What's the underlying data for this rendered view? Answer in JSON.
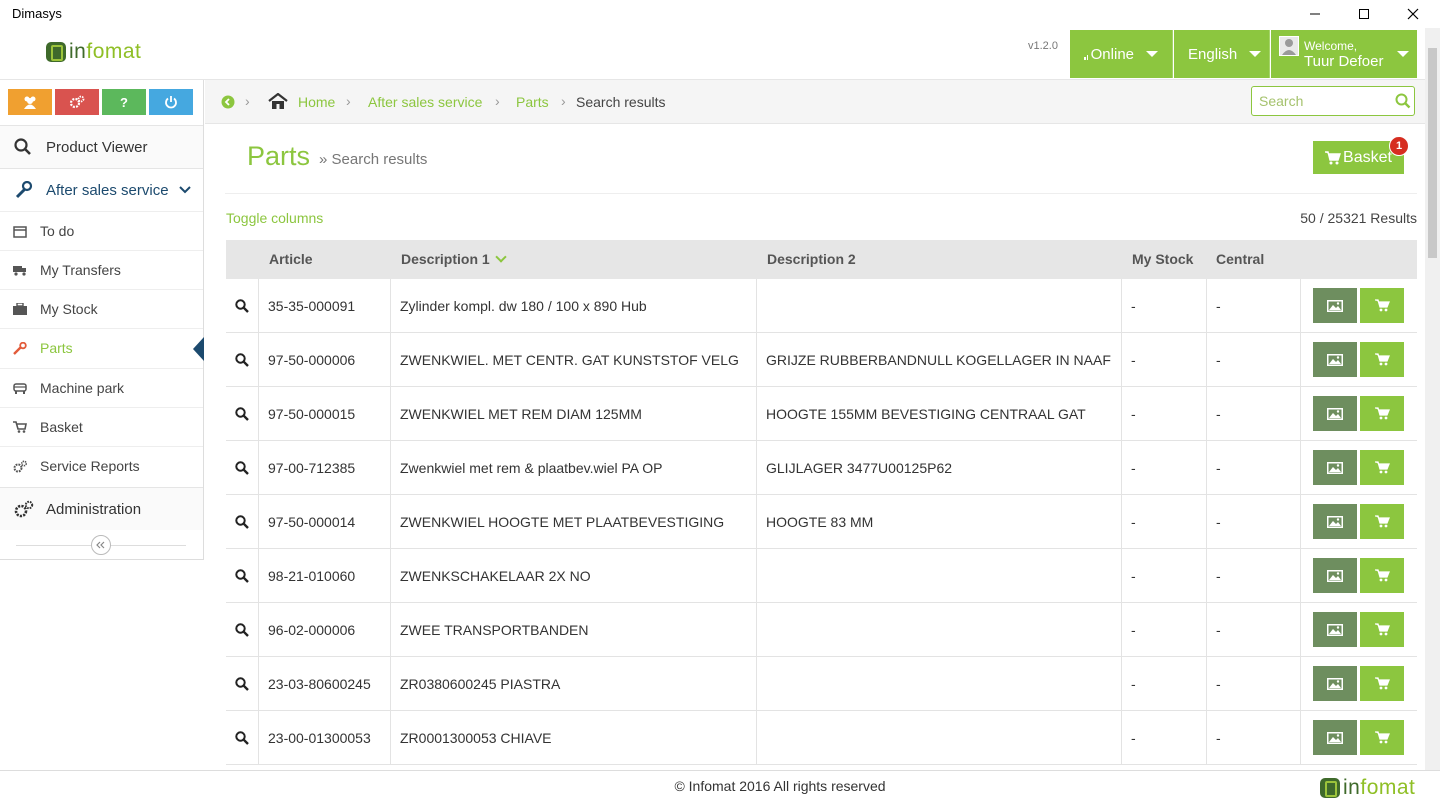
{
  "window": {
    "title": "Dimasys"
  },
  "header": {
    "logo_prefix": "in",
    "logo_suffix": "fomat",
    "version": "v1.2.0",
    "status_label": "Online",
    "language_label": "English",
    "welcome_label": "Welcome,",
    "user_name": "Tuur Defoer"
  },
  "sidebar": {
    "quick_buttons": [
      {
        "icon": "users-icon",
        "color": "#f0a030"
      },
      {
        "icon": "gears-icon",
        "color": "#d9534f"
      },
      {
        "label": "?",
        "icon": "help-icon",
        "color": "#5cb85c"
      },
      {
        "icon": "power-icon",
        "color": "#45a8e0"
      }
    ],
    "product_viewer": "Product Viewer",
    "after_sales": "After sales service",
    "items": [
      {
        "label": "To do",
        "icon": "calendar-icon"
      },
      {
        "label": "My Transfers",
        "icon": "truck-icon"
      },
      {
        "label": "My Stock",
        "icon": "briefcase-icon"
      },
      {
        "label": "Parts",
        "icon": "wrench-icon",
        "active": true
      },
      {
        "label": "Machine park",
        "icon": "machine-icon"
      },
      {
        "label": "Basket",
        "icon": "cart-icon"
      },
      {
        "label": "Service Reports",
        "icon": "gears-icon"
      }
    ],
    "administration": "Administration"
  },
  "breadcrumb": {
    "home": "Home",
    "after_sales": "After sales service",
    "parts": "Parts",
    "current": "Search results"
  },
  "search": {
    "placeholder": "Search"
  },
  "page": {
    "title": "Parts",
    "subtitle": "» Search results",
    "basket_label": "Basket",
    "basket_count": "1",
    "toggle_columns": "Toggle columns",
    "results": "50 / 25321 Results"
  },
  "table": {
    "columns": {
      "article": "Article",
      "desc1": "Description 1",
      "desc2": "Description 2",
      "my_stock": "My Stock",
      "central": "Central"
    },
    "rows": [
      {
        "article": "35-35-000091",
        "desc1": "Zylinder kompl. dw 180 / 100 x 890 Hub",
        "desc2": "",
        "my_stock": "-",
        "central": "-"
      },
      {
        "article": "97-50-000006",
        "desc1": "ZWENKWIEL. MET CENTR. GAT KUNSTSTOF VELG",
        "desc2": "GRIJZE RUBBERBANDNULL KOGELLAGER IN NAAF",
        "my_stock": "-",
        "central": "-"
      },
      {
        "article": "97-50-000015",
        "desc1": "ZWENKWIEL MET REM DIAM 125MM",
        "desc2": "HOOGTE 155MM BEVESTIGING CENTRAAL GAT",
        "my_stock": "-",
        "central": "-"
      },
      {
        "article": "97-00-712385",
        "desc1": "Zwenkwiel met rem & plaatbev.wiel PA OP",
        "desc2": "GLIJLAGER 3477U00125P62",
        "my_stock": "-",
        "central": "-"
      },
      {
        "article": "97-50-000014",
        "desc1": "ZWENKWIEL HOOGTE MET PLAATBEVESTIGING",
        "desc2": "HOOGTE 83 MM",
        "my_stock": "-",
        "central": "-"
      },
      {
        "article": "98-21-010060",
        "desc1": "ZWENKSCHAKELAAR 2X NO",
        "desc2": "",
        "my_stock": "-",
        "central": "-"
      },
      {
        "article": "96-02-000006",
        "desc1": "ZWEE TRANSPORTBANDEN",
        "desc2": "",
        "my_stock": "-",
        "central": "-"
      },
      {
        "article": "23-03-80600245",
        "desc1": "ZR0380600245 PIASTRA",
        "desc2": "",
        "my_stock": "-",
        "central": "-"
      },
      {
        "article": "23-00-01300053",
        "desc1": "ZR0001300053 CHIAVE",
        "desc2": "",
        "my_stock": "-",
        "central": "-"
      }
    ]
  },
  "footer": {
    "copyright": "© Infomat 2016 All rights reserved"
  },
  "colors": {
    "accent": "#8cc63f",
    "image_button": "#6e8e5f",
    "badge": "#d62d20"
  }
}
